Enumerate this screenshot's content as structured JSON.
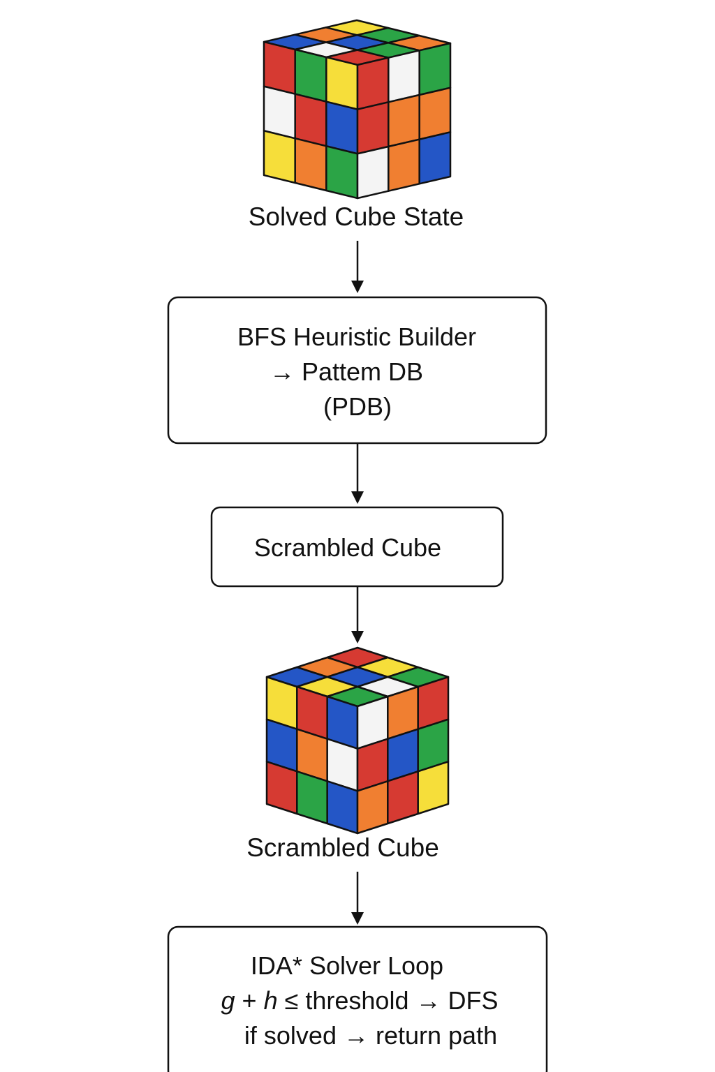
{
  "colors": {
    "red": "#D63A32",
    "green": "#2BA446",
    "blue": "#2456C6",
    "yellow": "#F6DE3A",
    "orange": "#F07F31",
    "white": "#F4F4F4",
    "stroke": "#111111"
  },
  "cubes": {
    "solved": {
      "label": "Solved Cube State",
      "top": [
        [
          "yellow",
          "green",
          "orange"
        ],
        [
          "orange",
          "blue",
          "green"
        ],
        [
          "blue",
          "white",
          "red"
        ]
      ],
      "left": [
        [
          "red",
          "green",
          "yellow"
        ],
        [
          "white",
          "red",
          "blue"
        ],
        [
          "yellow",
          "orange",
          "green"
        ]
      ],
      "right": [
        [
          "red",
          "white",
          "green"
        ],
        [
          "red",
          "orange",
          "orange"
        ],
        [
          "white",
          "orange",
          "blue"
        ]
      ]
    },
    "scrambled": {
      "label": "Scrambled Cube",
      "top": [
        [
          "red",
          "yellow",
          "green"
        ],
        [
          "orange",
          "blue",
          "white"
        ],
        [
          "blue",
          "yellow",
          "green"
        ]
      ],
      "left": [
        [
          "yellow",
          "red",
          "blue"
        ],
        [
          "blue",
          "orange",
          "white"
        ],
        [
          "red",
          "green",
          "blue"
        ]
      ],
      "right": [
        [
          "white",
          "orange",
          "red"
        ],
        [
          "red",
          "blue",
          "green"
        ],
        [
          "orange",
          "red",
          "yellow"
        ]
      ]
    }
  },
  "boxes": {
    "pdb": {
      "line1": "BFS Heuristic Builder",
      "line2": "→ Pattem DB",
      "line3": "(PDB)"
    },
    "scrambled": {
      "label": "Scrambled Cube"
    },
    "ida": {
      "line1": "IDA* Solver Loop",
      "line2_g": "g",
      "line2_plus": " + ",
      "line2_h": "h",
      "line2_rest": " ≤ threshold  → DFS",
      "line3": "if solved → return path"
    }
  }
}
